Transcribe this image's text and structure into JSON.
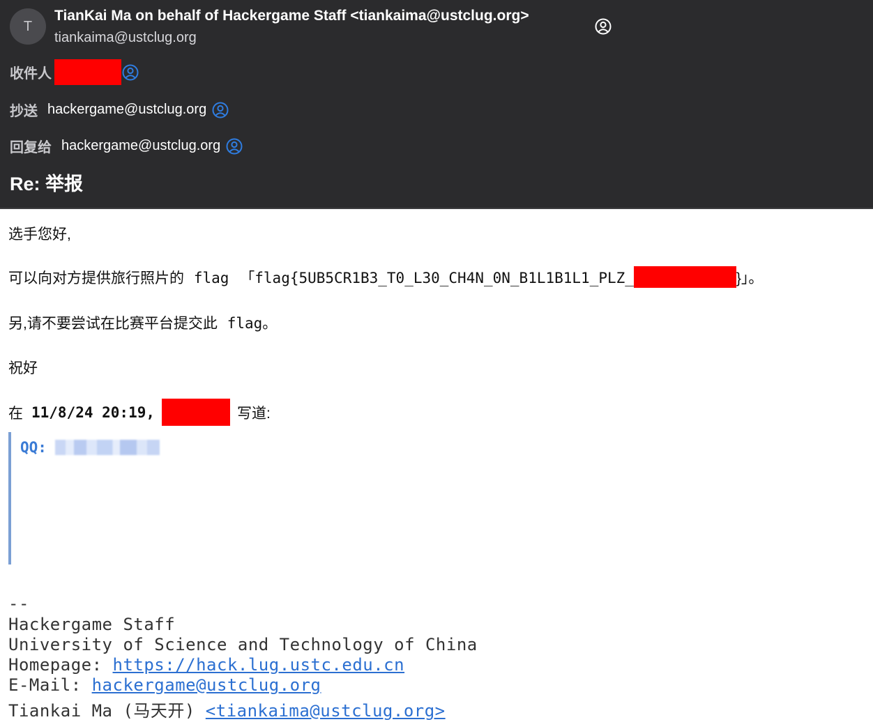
{
  "header": {
    "avatar_initial": "T",
    "from": "TianKai Ma on behalf of Hackergame Staff <tiankaima@ustclug.org>",
    "from_email": "tiankaima@ustclug.org",
    "to_label": "收件人",
    "cc_label": "抄送",
    "cc_value": "hackergame@ustclug.org",
    "reply_to_label": "回复给",
    "reply_to_value": "hackergame@ustclug.org",
    "subject": "Re: 举报"
  },
  "body": {
    "greeting": "选手您好,",
    "line1_prefix": "可以向对方提供旅行照片的",
    "line1_flag_word": "flag",
    "line1_open": "「",
    "line1_flag": "flag{5UB5CR1B3_T0_L30_CH4N_0N_B1L1B1L1_PLZ_",
    "line1_close": "}」。",
    "line2_prefix": "另,请不要尝试在比赛平台提交此",
    "line2_flag": "flag",
    "line2_suffix": "。",
    "closing": "祝好",
    "quote_intro_prefix": "在",
    "quote_intro_date": "11/8/24 20:19,",
    "quote_intro_suffix": "写道:",
    "quote_qq_label": "QQ:"
  },
  "signature": {
    "separator": "--",
    "name": "Hackergame Staff",
    "org": "University of Science and Technology of China",
    "homepage_label": "Homepage: ",
    "homepage_url": "https://hack.lug.ustc.edu.cn",
    "email_label": "E-Mail: ",
    "email": "hackergame@ustclug.org",
    "person_prefix": "Tiankai Ma (马天开) ",
    "person_email": "<tiankaima@ustclug.org>"
  },
  "colors": {
    "header_bg": "#2b2b2d",
    "redaction": "#ff0000",
    "link": "#2b6fd1",
    "contact_icon": "#2f7de1",
    "quote_bar": "#7b9fd4"
  },
  "icons": [
    "person-circle-icon"
  ]
}
